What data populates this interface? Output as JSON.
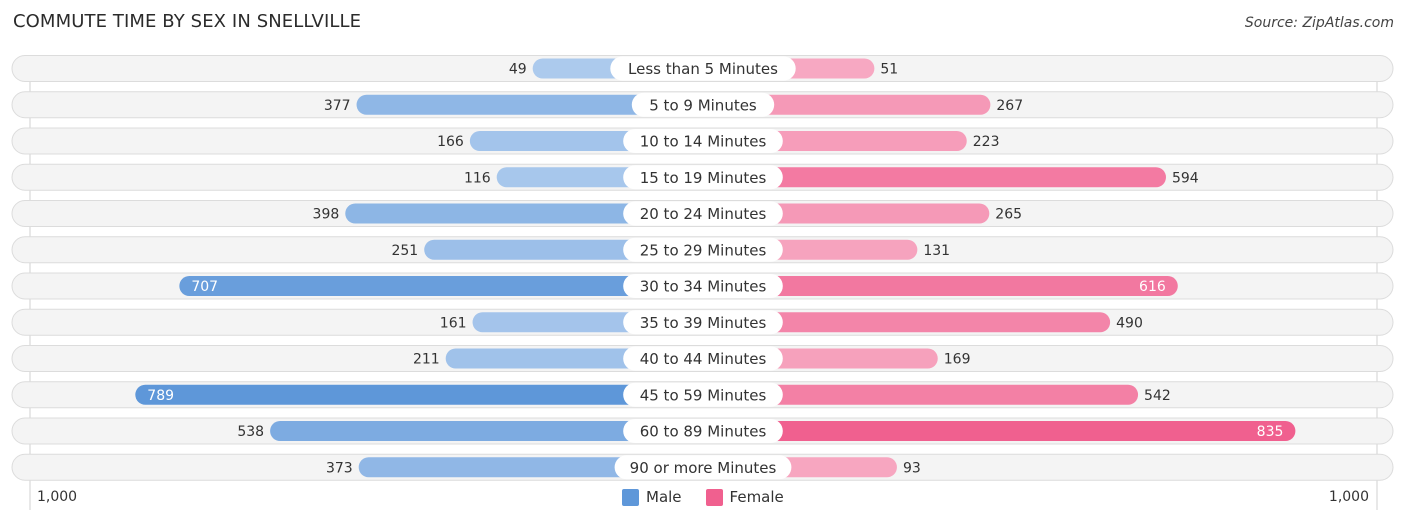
{
  "title": "COMMUTE TIME BY SEX IN SNELLVILLE",
  "source": "Source: ZipAtlas.com",
  "legend": {
    "male_label": "Male",
    "female_label": "Female"
  },
  "axis": {
    "left_label": "1,000",
    "right_label": "1,000"
  },
  "colors": {
    "male_light": "#aecbee",
    "male_dark": "#5e97d9",
    "female_light": "#f7aac3",
    "female_dark": "#f0608f",
    "row_bg": "#f4f4f4",
    "row_border": "#dcdcdc"
  },
  "chart_data": {
    "type": "bar",
    "orientation": "horizontal-diverging",
    "title": "COMMUTE TIME BY SEX IN SNELLVILLE",
    "categories": [
      "Less than 5 Minutes",
      "5 to 9 Minutes",
      "10 to 14 Minutes",
      "15 to 19 Minutes",
      "20 to 24 Minutes",
      "25 to 29 Minutes",
      "30 to 34 Minutes",
      "35 to 39 Minutes",
      "40 to 44 Minutes",
      "45 to 59 Minutes",
      "60 to 89 Minutes",
      "90 or more Minutes"
    ],
    "series": [
      {
        "name": "Male",
        "values": [
          49,
          377,
          166,
          116,
          398,
          251,
          707,
          161,
          211,
          789,
          538,
          373
        ]
      },
      {
        "name": "Female",
        "values": [
          51,
          267,
          223,
          594,
          265,
          131,
          616,
          490,
          169,
          542,
          835,
          93
        ]
      }
    ],
    "xlim": [
      0,
      1000
    ],
    "legend_position": "bottom-center"
  }
}
